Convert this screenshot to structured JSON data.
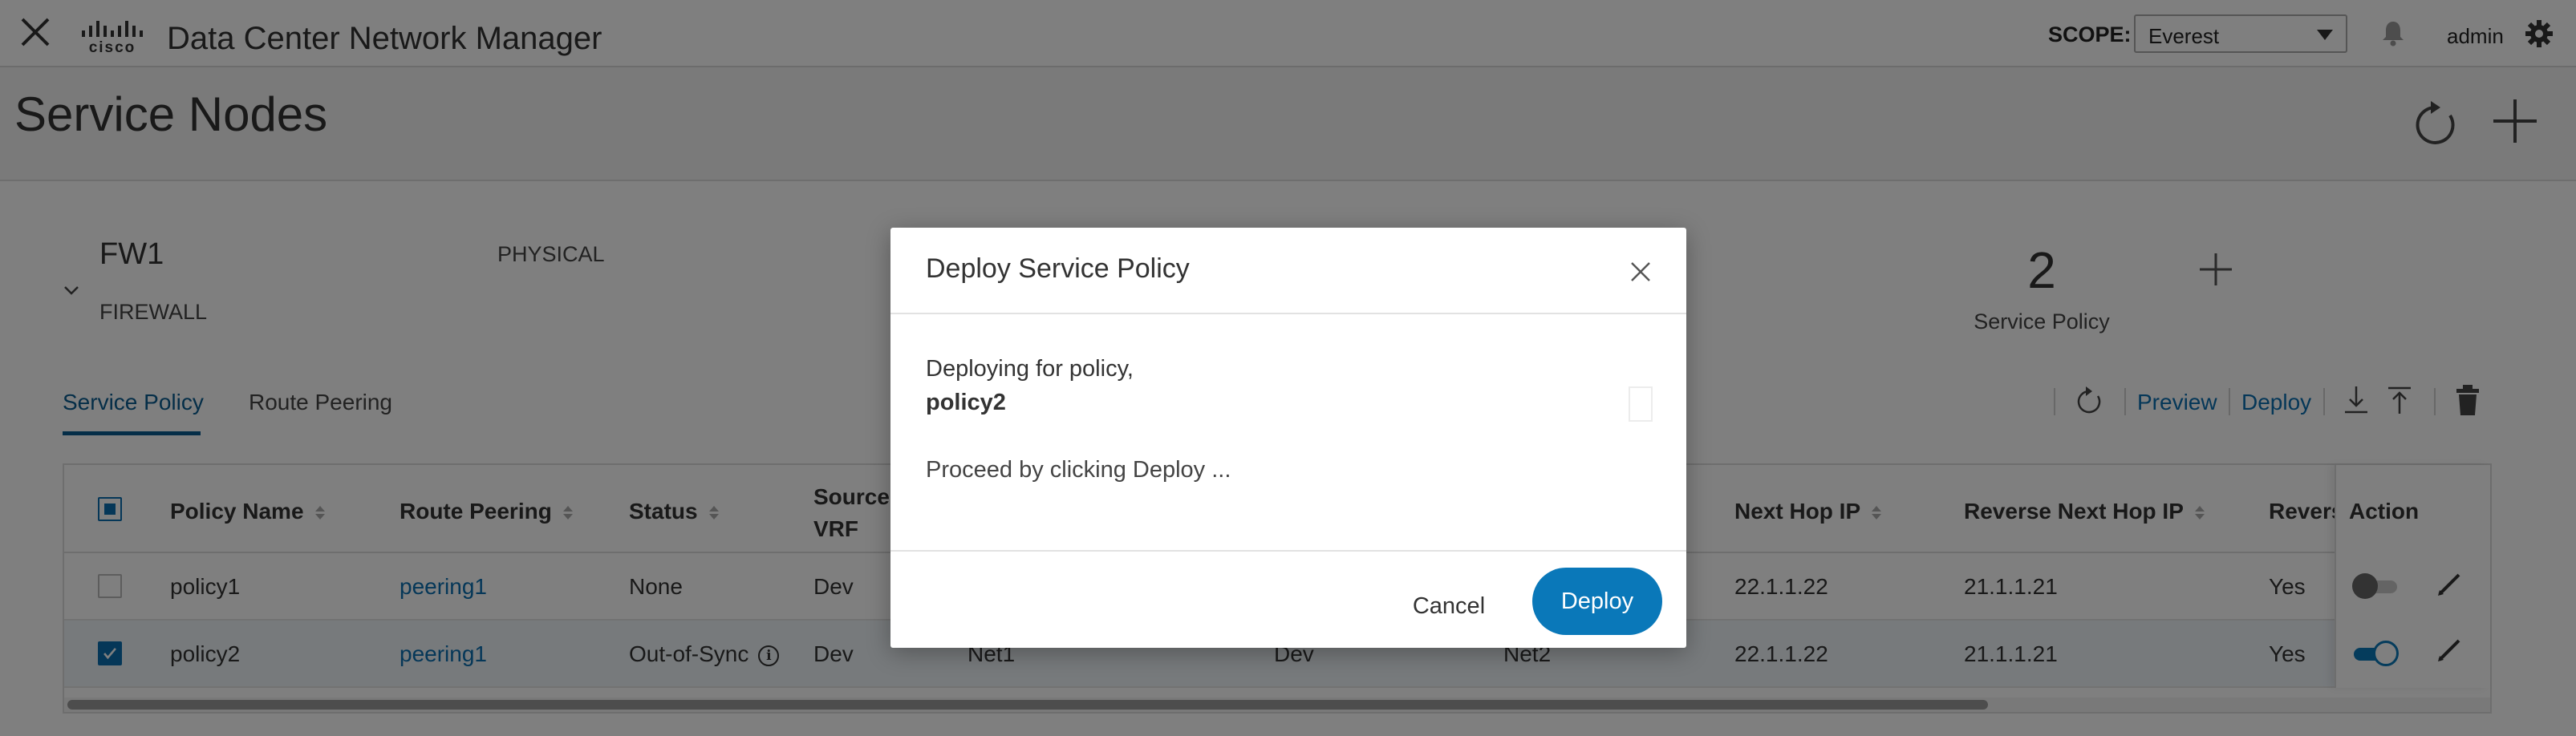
{
  "header": {
    "app_title": "Data Center Network Manager",
    "logo_text": "cisco",
    "scope_label": "SCOPE:",
    "scope_value": "Everest",
    "user": "admin"
  },
  "page": {
    "title": "Service Nodes"
  },
  "node": {
    "name": "FW1",
    "type": "FIREWALL",
    "form_factor": "PHYSICAL",
    "policy_count": "2",
    "policy_count_label": "Service Policy"
  },
  "tabs": [
    {
      "label": "Service Policy",
      "active": true
    },
    {
      "label": "Route Peering",
      "active": false
    }
  ],
  "toolbar": {
    "preview_label": "Preview",
    "deploy_label": "Deploy"
  },
  "table": {
    "columns": {
      "policy_name": "Policy Name",
      "route_peering": "Route Peering",
      "status": "Status",
      "source_vrf_1": "Source",
      "source_vrf_2": "VRF",
      "next_hop_ip": "Next Hop IP",
      "reverse_next_hop_ip": "Reverse Next Hop IP",
      "reverse": "Revers",
      "action": "Action"
    },
    "rows": [
      {
        "checked": false,
        "policy_name": "policy1",
        "route_peering": "peering1",
        "status": "None",
        "source_vrf": "Dev",
        "source_network": "",
        "dest_vrf": "",
        "dest_network": "",
        "next_hop_ip": "22.1.1.22",
        "reverse_next_hop_ip": "21.1.1.21",
        "reverse": "Yes",
        "enabled": false
      },
      {
        "checked": true,
        "policy_name": "policy2",
        "route_peering": "peering1",
        "status": "Out-of-Sync",
        "source_vrf": "Dev",
        "source_network": "Net1",
        "dest_vrf": "Dev",
        "dest_network": "Net2",
        "next_hop_ip": "22.1.1.22",
        "reverse_next_hop_ip": "21.1.1.21",
        "reverse": "Yes",
        "enabled": true
      }
    ]
  },
  "modal": {
    "title": "Deploy Service Policy",
    "line1": "Deploying for policy,",
    "policy": "policy2",
    "line2": "Proceed by clicking Deploy ...",
    "cancel_label": "Cancel",
    "deploy_label": "Deploy"
  },
  "colors": {
    "accent": "#0a78b9",
    "link": "#0a6fb0",
    "overlay": "#000000"
  }
}
